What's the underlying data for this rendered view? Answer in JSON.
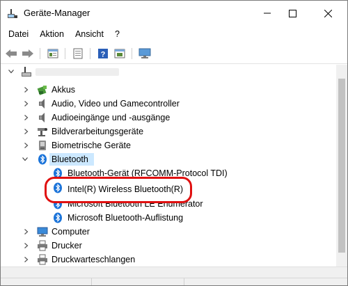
{
  "window": {
    "title": "Geräte-Manager",
    "controls": {
      "minimize": "minimize",
      "maximize": "maximize",
      "close": "close"
    }
  },
  "menu": [
    "Datei",
    "Aktion",
    "Ansicht",
    "?"
  ],
  "toolbar": {
    "buttons": [
      "back-arrow-icon",
      "forward-arrow-icon",
      "properties-icon",
      "update-driver-icon",
      "help-icon",
      "show-hidden-icon",
      "monitor-icon"
    ]
  },
  "tree": {
    "root_label": "",
    "categories": [
      {
        "label": "Akkus",
        "icon": "battery-icon",
        "expanded": false
      },
      {
        "label": "Audio, Video und Gamecontroller",
        "icon": "speaker-icon",
        "expanded": false
      },
      {
        "label": "Audioeingänge und -ausgänge",
        "icon": "speaker-icon",
        "expanded": false
      },
      {
        "label": "Bildverarbeitungsgeräte",
        "icon": "camera-icon",
        "expanded": false
      },
      {
        "label": "Biometrische Geräte",
        "icon": "fingerprint-icon",
        "expanded": false
      },
      {
        "label": "Bluetooth",
        "icon": "bluetooth-icon",
        "expanded": true,
        "selected": true
      }
    ],
    "bluetooth_children": [
      {
        "label": "Bluetooth-Gerät (RFCOMM-Protocol TDI)",
        "icon": "bluetooth-icon"
      },
      {
        "label": "Intel(R) Wireless Bluetooth(R)",
        "icon": "bluetooth-icon"
      },
      {
        "label": "Microsoft Bluetooth LE Enumerator",
        "icon": "bluetooth-icon"
      },
      {
        "label": "Microsoft Bluetooth-Auflistung",
        "icon": "bluetooth-icon"
      }
    ],
    "more_categories": [
      {
        "label": "Computer",
        "icon": "computer-icon",
        "expanded": false
      },
      {
        "label": "Drucker",
        "icon": "printer-icon",
        "expanded": false
      },
      {
        "label": "Druckwarteschlangen",
        "icon": "printer-icon",
        "expanded": false
      }
    ]
  },
  "colors": {
    "selection": "#cce8ff",
    "highlight_ring": "#e01010",
    "bluetooth_blue": "#1a73d9"
  }
}
